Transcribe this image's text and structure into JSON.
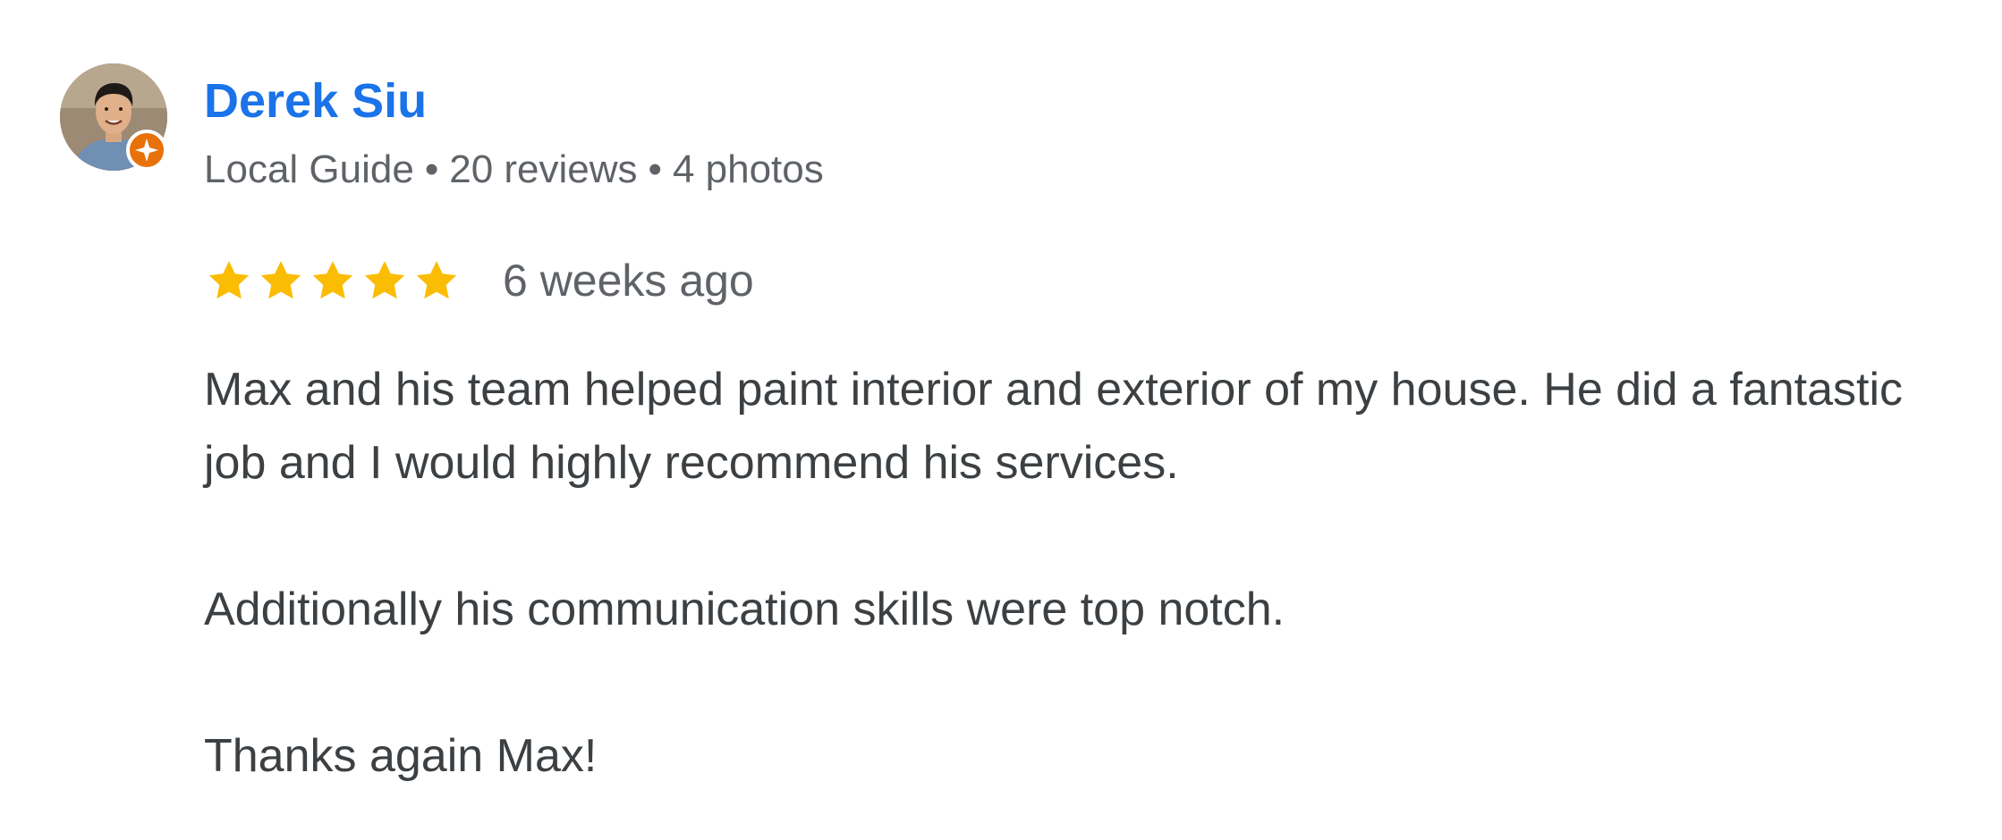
{
  "reviewer": {
    "name": "Derek Siu",
    "badge": "Local Guide",
    "reviews_count": "20 reviews",
    "photos_count": "4 photos",
    "separator": "•",
    "avatar_icon": "person-photo-avatar",
    "badge_icon": "local-guide-star-icon"
  },
  "rating": {
    "value": 5,
    "max": 5,
    "time_ago": "6 weeks ago",
    "star_color": "#fbbc04"
  },
  "review": {
    "paragraphs": [
      "Max and his team helped paint interior and exterior of my house. He did a fantastic job and I would highly recommend his services.",
      "Additionally his communication skills were top notch.",
      "Thanks again Max!"
    ]
  },
  "colors": {
    "name_link": "#1a73e8",
    "meta_text": "#5f6368",
    "body_text": "#3c4043",
    "guide_badge": "#e8710a"
  }
}
